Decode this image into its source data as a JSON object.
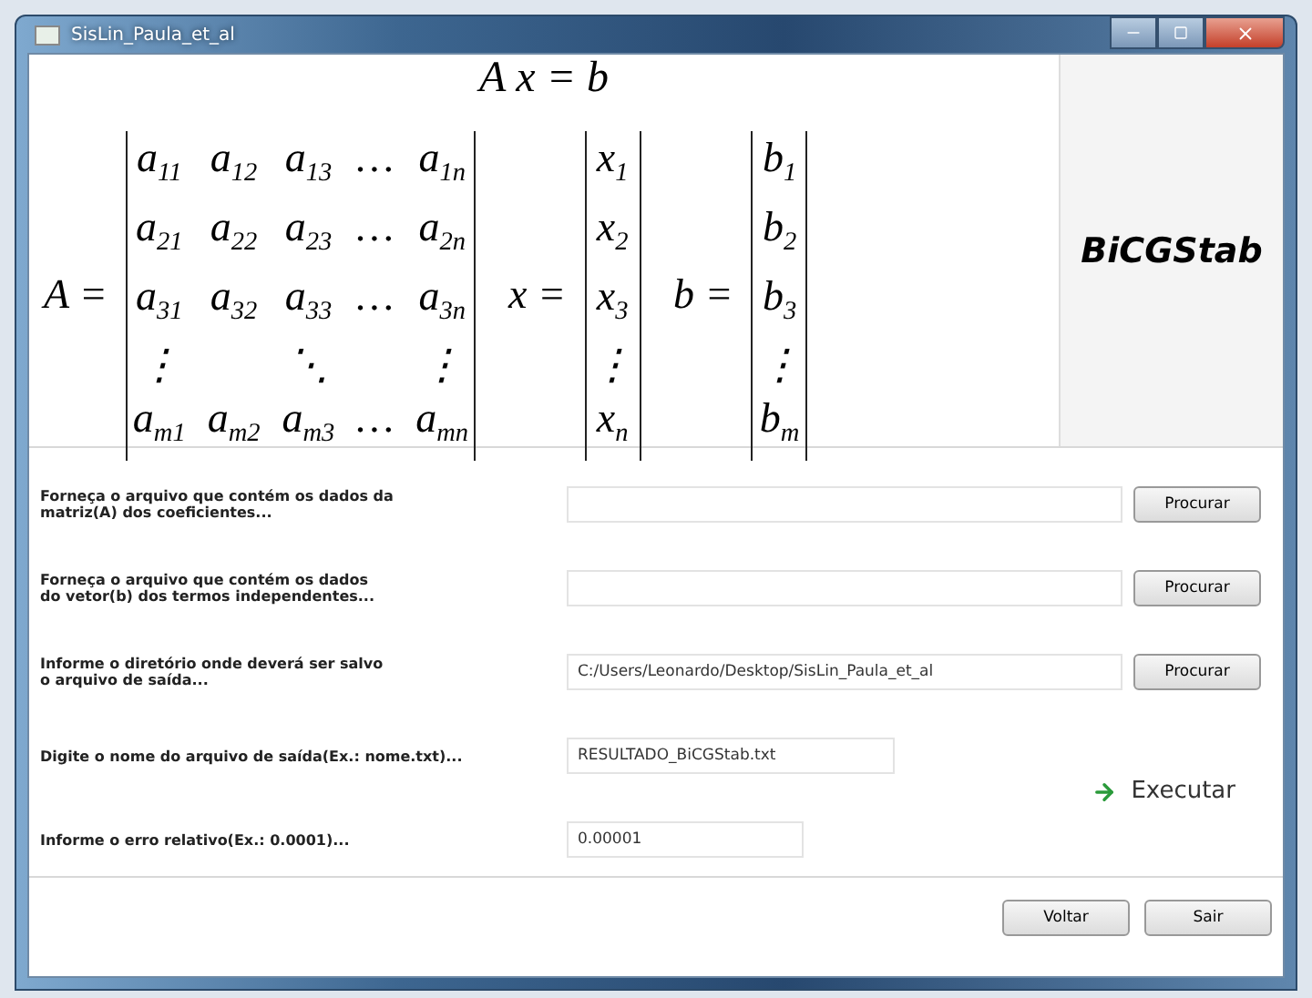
{
  "window": {
    "title": "SisLin_Paula_et_al"
  },
  "equation": {
    "title": "A x = b",
    "matrix_a": {
      "label": "A =",
      "rows": [
        [
          "a$_{11}$",
          "a$_{12}$",
          "a$_{13}$",
          "…",
          "a$_{1n}$"
        ],
        [
          "a$_{21}$",
          "a$_{22}$",
          "a$_{23}$",
          "…",
          "a$_{2n}$"
        ],
        [
          "a$_{31}$",
          "a$_{32}$",
          "a$_{33}$",
          "…",
          "a$_{3n}$"
        ],
        [
          "⋮",
          "",
          "⋱",
          "",
          "⋮"
        ],
        [
          "a$_{m1}$",
          "a$_{m2}$",
          "a$_{m3}$",
          "…",
          "a$_{mn}$"
        ]
      ]
    },
    "vectors": [
      {
        "label": "x =",
        "entries": [
          "x$_{1}$",
          "x$_{2}$",
          "x$_{3}$",
          "⋮",
          "x$_{n}$"
        ]
      },
      {
        "label": "b =",
        "entries": [
          "b$_{1}$",
          "b$_{2}$",
          "b$_{3}$",
          "⋮",
          "b$_{m}$"
        ]
      }
    ]
  },
  "method": "BiCGStab",
  "form": [
    {
      "kind": "file",
      "label": "Forneça o arquivo que contém os dados da\nmatriz(A) dos coeficientes...",
      "button": "Procurar"
    },
    {
      "kind": "file",
      "label": "Forneça o arquivo que contém os dados\ndo vetor(b) dos termos independentes...",
      "button": "Procurar"
    },
    {
      "kind": "file",
      "label": "Informe o diretório onde deverá ser salvo\no arquivo de saída...",
      "value": "C:/Users/Leonardo/Desktop/SisLin_Paula_et_al",
      "button": "Procurar"
    },
    {
      "kind": "text",
      "label": "Digite o nome do arquivo de saída(Ex.: nome.txt)...",
      "value": "RESULTADO_BiCGStab.txt"
    },
    {
      "kind": "text",
      "label": "Informe o erro relativo(Ex.: 0.0001)...",
      "value": "0.00001"
    }
  ],
  "execute": "Executar",
  "buttons": [
    "Voltar",
    "Sair"
  ]
}
